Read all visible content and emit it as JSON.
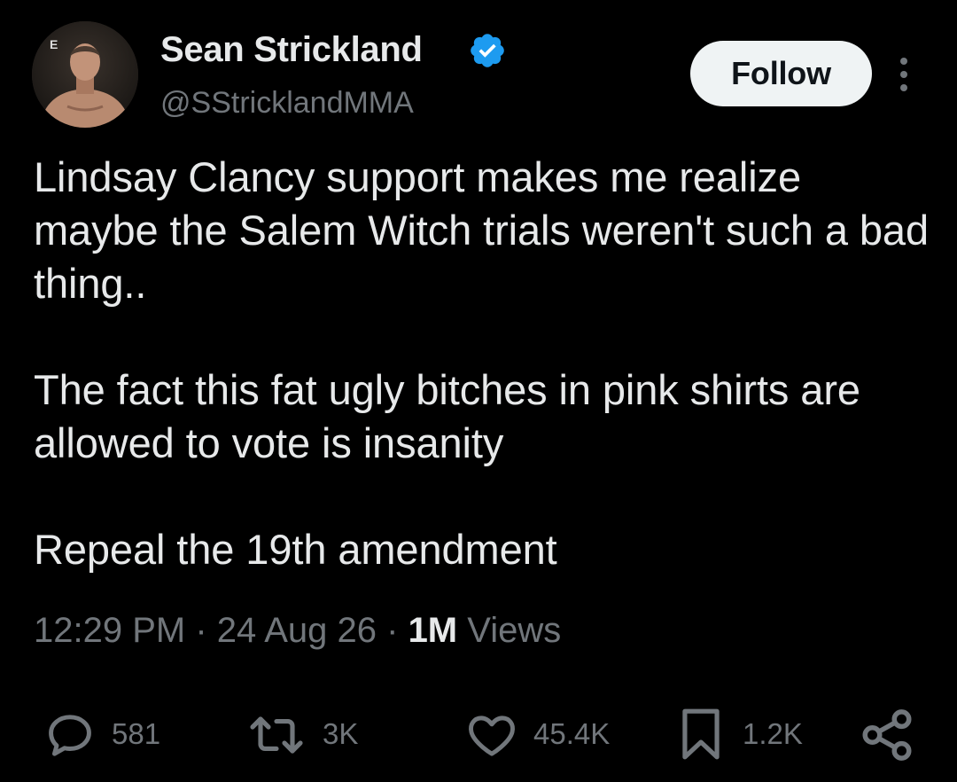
{
  "user": {
    "display_name": "Sean Strickland",
    "handle": "@SStricklandMMA",
    "avatar_logo": "E"
  },
  "follow_label": "Follow",
  "tweet": {
    "paragraphs": [
      "Lindsay Clancy support makes me realize maybe the Salem Witch trials weren't such a bad thing..",
      "The fact this fat ugly bitches in pink shirts are allowed to vote is insanity",
      "Repeal the 19th amendment"
    ]
  },
  "meta": {
    "time": "12:29 PM",
    "separator": "·",
    "date": "24 Aug 26",
    "views_count": "1M",
    "views_label": "Views"
  },
  "actions": {
    "replies": "581",
    "reposts": "3K",
    "likes": "45.4K",
    "bookmarks": "1.2K"
  },
  "colors": {
    "background": "#000000",
    "primary_text": "#e7e9ea",
    "secondary_text": "#71767b",
    "verified": "#1d9bf0",
    "follow_bg": "#eff3f4"
  }
}
